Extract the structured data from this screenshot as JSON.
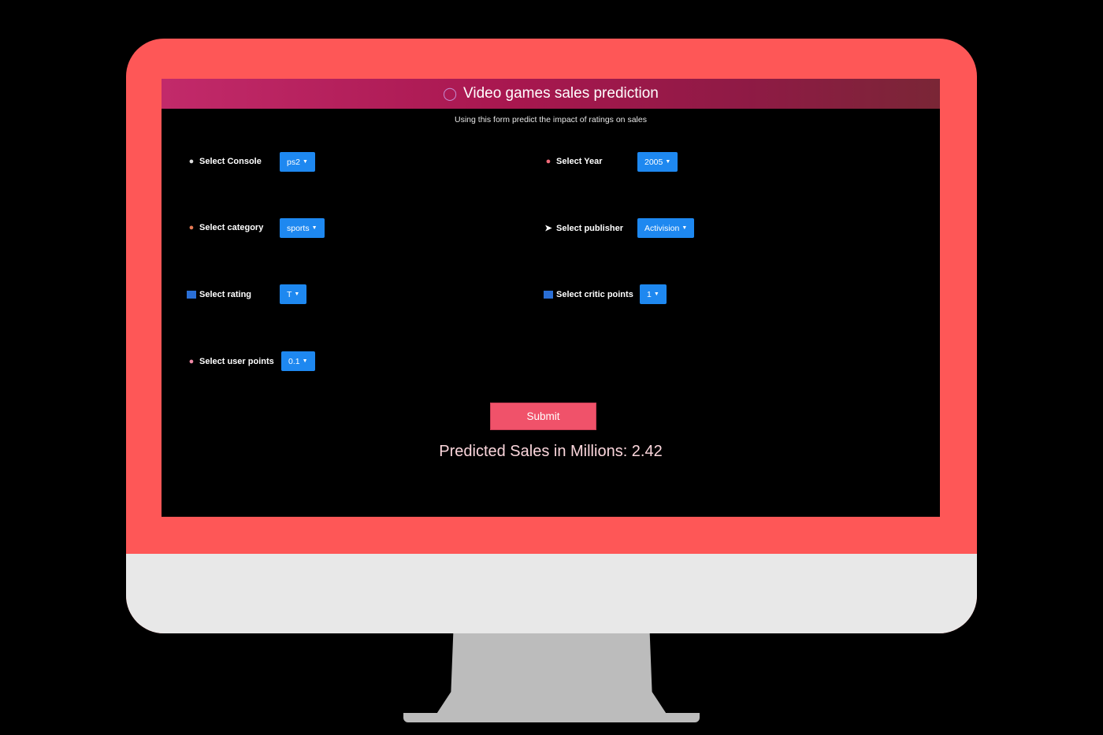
{
  "header": {
    "title": "Video games sales prediction",
    "icon": "gamepad-icon"
  },
  "subtitle": "Using this form predict the impact of ratings on sales",
  "fields": {
    "console": {
      "label": "Select Console",
      "icon": "joystick-icon",
      "value": "ps2"
    },
    "year": {
      "label": "Select Year",
      "icon": "alarm-clock-icon",
      "value": "2005"
    },
    "category": {
      "label": "Select category",
      "icon": "palette-icon",
      "value": "sports"
    },
    "publisher": {
      "label": "Select publisher",
      "icon": "arrow-icon",
      "value": "Activision"
    },
    "rating": {
      "label": "Select rating",
      "icon": "numbers-icon",
      "value": "T"
    },
    "critic_points": {
      "label": "Select critic points",
      "icon": "numbers-icon",
      "value": "1"
    },
    "user_points": {
      "label": "Select user points",
      "icon": "lock-icon",
      "value": "0.1"
    }
  },
  "submit_label": "Submit",
  "result": "Predicted Sales in Millions: 2.42",
  "colors": {
    "frame": "#fe5757",
    "chin": "#e8e8e8",
    "stand": "#bcbcbc",
    "dropdown": "#1e88f0",
    "submit": "#f0526a"
  }
}
